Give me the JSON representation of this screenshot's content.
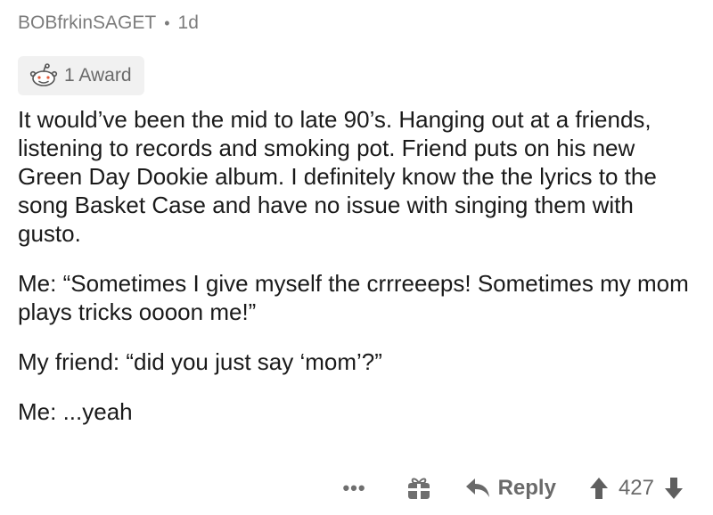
{
  "comment": {
    "author": "BOBfrkinSAGET",
    "separator": "•",
    "age": "1d",
    "award_label": "1 Award",
    "paragraphs": [
      "It would’ve been the mid to late 90’s. Hanging out at a friends, listening to records and smoking pot. Friend puts on his new Green Day Dookie album. I definitely know the the lyrics to the song Basket Case and have no issue with singing them with gusto.",
      "Me: “Sometimes I give myself the crrreeeps! Sometimes my mom plays tricks oooon me!”",
      "My friend: “did you just say ‘mom’?”",
      "Me: ...yeah"
    ]
  },
  "actions": {
    "more_label": "•••",
    "reply_label": "Reply",
    "score": "427"
  },
  "icons": {
    "award": "award-icon",
    "gift": "gift-icon",
    "reply": "reply-arrow-icon",
    "upvote": "upvote-arrow-icon",
    "downvote": "downvote-arrow-icon"
  },
  "colors": {
    "meta_text": "#7c7c7c",
    "award_bg": "#f1f1f1",
    "action_text": "#6f6f6f"
  }
}
